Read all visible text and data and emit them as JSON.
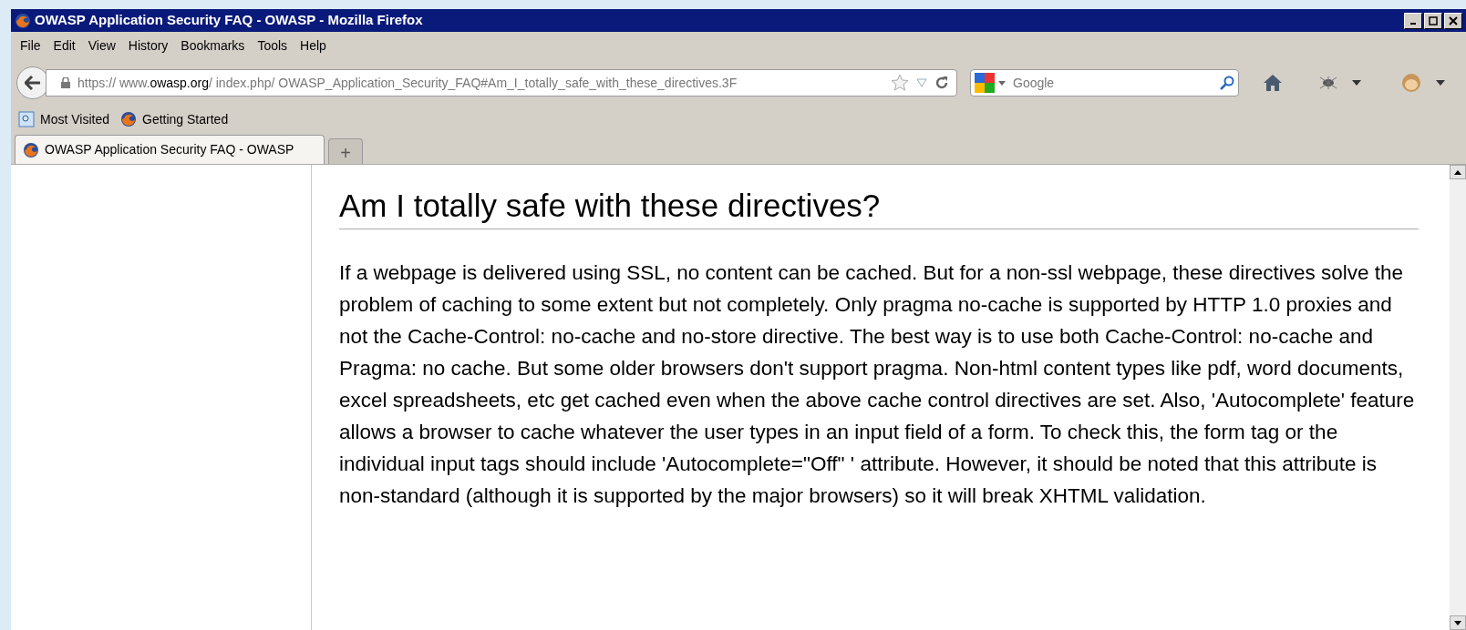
{
  "window": {
    "title": "OWASP Application Security FAQ - OWASP - Mozilla Firefox"
  },
  "menu": [
    "File",
    "Edit",
    "View",
    "History",
    "Bookmarks",
    "Tools",
    "Help"
  ],
  "address_bar": {
    "scheme": "https://",
    "domain_prefix": "www.",
    "domain": "owasp.org",
    "path": "/ index.php/ OWASP_Application_Security_FAQ#Am_I_totally_safe_with_these_directives.3F"
  },
  "search": {
    "placeholder": "Google"
  },
  "bookmarks": [
    "Most Visited",
    "Getting Started"
  ],
  "tabs": [
    {
      "label": "OWASP Application Security FAQ - OWASP",
      "selected": true
    },
    {
      "label": "+",
      "selected": false
    }
  ],
  "article": {
    "heading": "Am I totally safe with these directives?",
    "paragraph": "If a webpage is delivered using SSL, no content can be cached. But for a non-ssl webpage, these directives solve the problem of caching to some extent but not completely. Only pragma no-cache is supported by HTTP 1.0 proxies and not the Cache-Control: no-cache and no-store directive. The best way is to use both Cache-Control: no-cache and Pragma: no cache. But some older browsers don't support pragma. Non-html content types like pdf, word documents, excel spreadsheets, etc get cached even when the above cache control directives are set. Also, 'Autocomplete' feature allows a browser to cache whatever the user types in an input field of a form. To check this, the form tag or the individual input tags should include 'Autocomplete=\"Off\" ' attribute. However, it should be noted that this attribute is non-standard (although it is supported by the major browsers) so it will break XHTML validation."
  }
}
